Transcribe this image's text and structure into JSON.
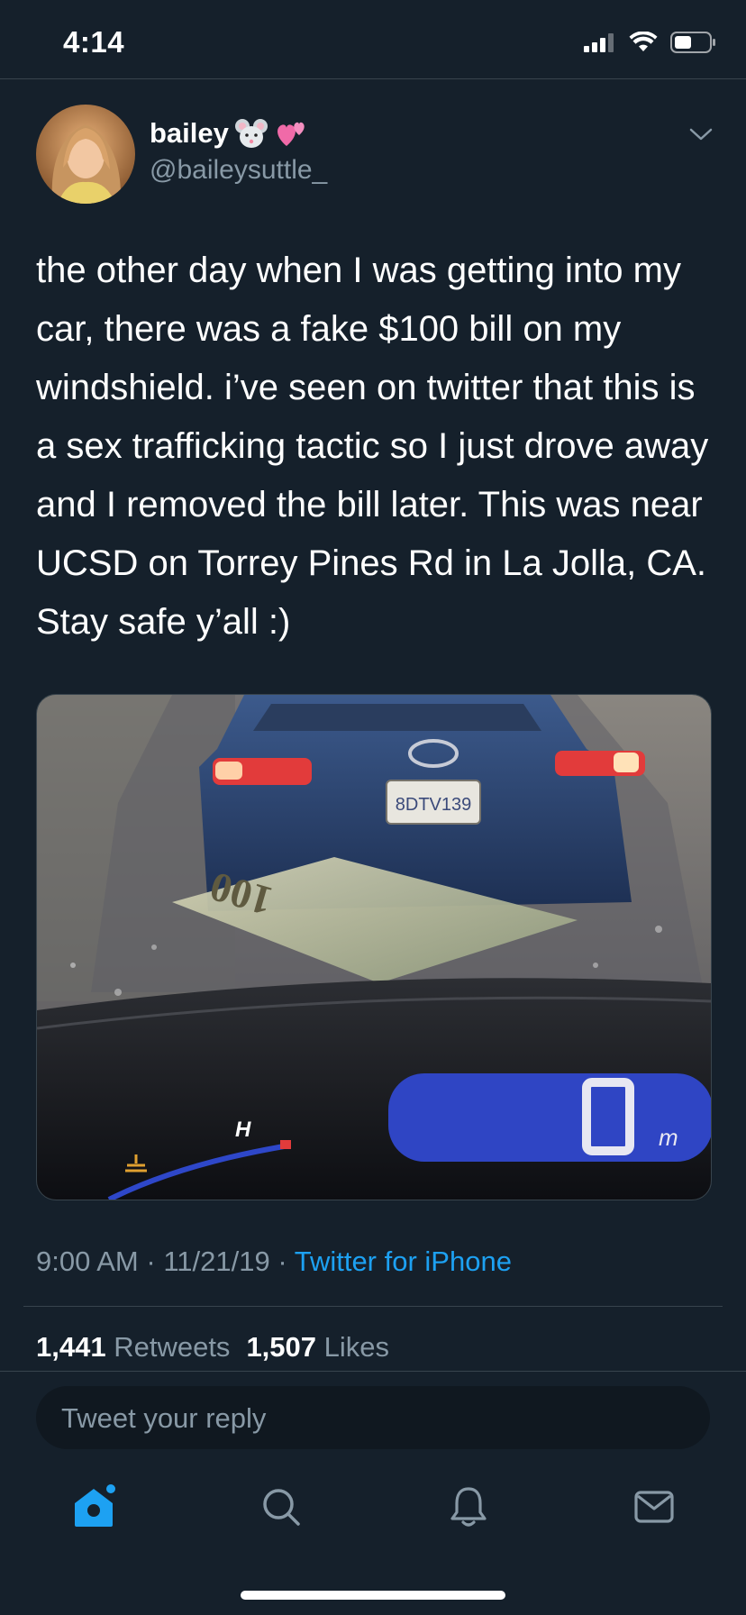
{
  "status_bar": {
    "time": "4:14"
  },
  "tweet": {
    "display_name": "bailey",
    "name_emojis": [
      "mouse-face",
      "two-hearts"
    ],
    "handle": "@baileysuttle_",
    "text": "the other day when I was getting into my car, there was a fake $100 bill on my windshield. i’ve seen on twitter that this is a sex trafficking tactic so I just drove away and I removed the bill later. This was near UCSD on Torrey Pines Rd in La Jolla, CA. Stay safe y’all :)",
    "media": {
      "plate_text": "8DTV139",
      "bill_text": "100",
      "gauge_letter": "H",
      "speed_digit": "0",
      "speed_unit": "m"
    },
    "time": "9:00 AM",
    "date": "11/21/19",
    "separator": "·",
    "source": "Twitter for iPhone",
    "retweets_count": "1,441",
    "retweets_label": "Retweets",
    "likes_count": "1,507",
    "likes_label": "Likes"
  },
  "reply": {
    "placeholder": "Tweet your reply"
  },
  "tabbar": {
    "tabs": [
      {
        "icon": "home-icon",
        "active": true
      },
      {
        "icon": "search-icon",
        "active": false
      },
      {
        "icon": "notifications-icon",
        "active": false
      },
      {
        "icon": "messages-icon",
        "active": false
      }
    ]
  },
  "colors": {
    "background": "#15202b",
    "accent": "#1da1f2",
    "secondary_text": "#8899a6",
    "divider": "#38444d"
  }
}
